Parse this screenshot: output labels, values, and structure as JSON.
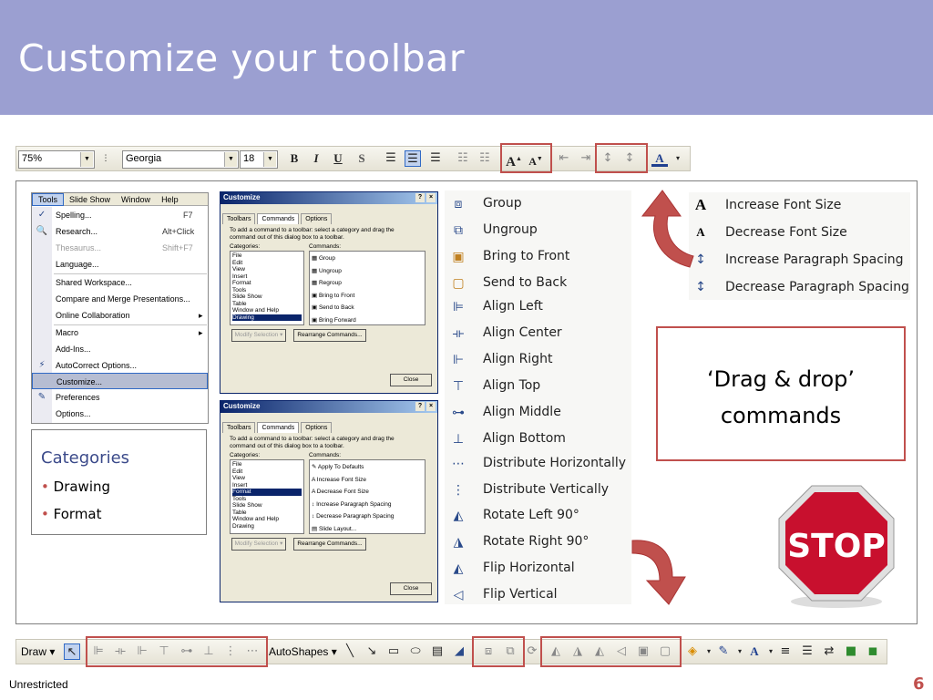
{
  "slide": {
    "title": "Customize your toolbar",
    "footer": "Unrestricted",
    "page_number": "6"
  },
  "format_toolbar": {
    "zoom": "75%",
    "font": "Georgia",
    "size": "18",
    "bold": "B",
    "italic": "I",
    "underline": "U",
    "shadow": "S",
    "font_color": "A"
  },
  "tools_menu": {
    "menubar": [
      "Tools",
      "Slide Show",
      "Window",
      "Help"
    ],
    "items": [
      {
        "label": "Spelling...",
        "shortcut": "F7"
      },
      {
        "label": "Research...",
        "shortcut": "Alt+Click"
      },
      {
        "label": "Thesaurus...",
        "shortcut": "Shift+F7"
      },
      {
        "label": "Language..."
      },
      {
        "label": "Shared Workspace..."
      },
      {
        "label": "Compare and Merge Presentations..."
      },
      {
        "label": "Online Collaboration"
      },
      {
        "label": "Macro"
      },
      {
        "label": "Add-Ins..."
      },
      {
        "label": "AutoCorrect Options..."
      },
      {
        "label": "Customize..."
      },
      {
        "label": "Preferences"
      },
      {
        "label": "Options..."
      }
    ]
  },
  "customize_dialog": {
    "title": "Customize",
    "help": "?",
    "close_x": "×",
    "tabs": [
      "Toolbars",
      "Commands",
      "Options"
    ],
    "instructions_1": "To add a command to a toolbar: select a category and drag the",
    "instructions_2": "command out of this dialog box to a toolbar.",
    "categories_label": "Categories:",
    "commands_label": "Commands:",
    "categories": [
      "File",
      "Edit",
      "View",
      "Insert",
      "Format",
      "Tools",
      "Slide Show",
      "Table",
      "Window and Help",
      "Drawing"
    ],
    "drawing_commands": [
      "Group",
      "Ungroup",
      "Regroup",
      "Bring to Front",
      "Send to Back",
      "Bring Forward"
    ],
    "format_commands": [
      "Apply To Defaults",
      "Increase Font Size",
      "Decrease Font Size",
      "Increase Paragraph Spacing",
      "Decrease Paragraph Spacing",
      "Slide Layout..."
    ],
    "modify_selection": "Modify Selection ▾",
    "rearrange": "Rearrange Commands...",
    "close": "Close"
  },
  "drawing_list": [
    "Group",
    "Ungroup",
    "Bring to Front",
    "Send to Back",
    "Align Left",
    "Align Center",
    "Align Right",
    "Align Top",
    "Align Middle",
    "Align Bottom",
    "Distribute Horizontally",
    "Distribute Vertically",
    "Rotate Left 90°",
    "Rotate Right 90°",
    "Flip Horizontal",
    "Flip Vertical"
  ],
  "format_list": [
    "Increase Font Size",
    "Decrease Font Size",
    "Increase Paragraph Spacing",
    "Decrease Paragraph Spacing"
  ],
  "categories_box": {
    "heading": "Categories",
    "items": [
      "Drawing",
      "Format"
    ]
  },
  "drag_box": {
    "line1": "‘Drag & drop’",
    "line2": "commands"
  },
  "stop_sign": "STOP",
  "draw_toolbar": {
    "draw": "Draw ▾",
    "autoshapes": "AutoShapes ▾"
  },
  "colors": {
    "header": "#9b9fd1",
    "highlight": "#c0504d",
    "arrow": "#c0504d",
    "stop": "#c8102e"
  }
}
